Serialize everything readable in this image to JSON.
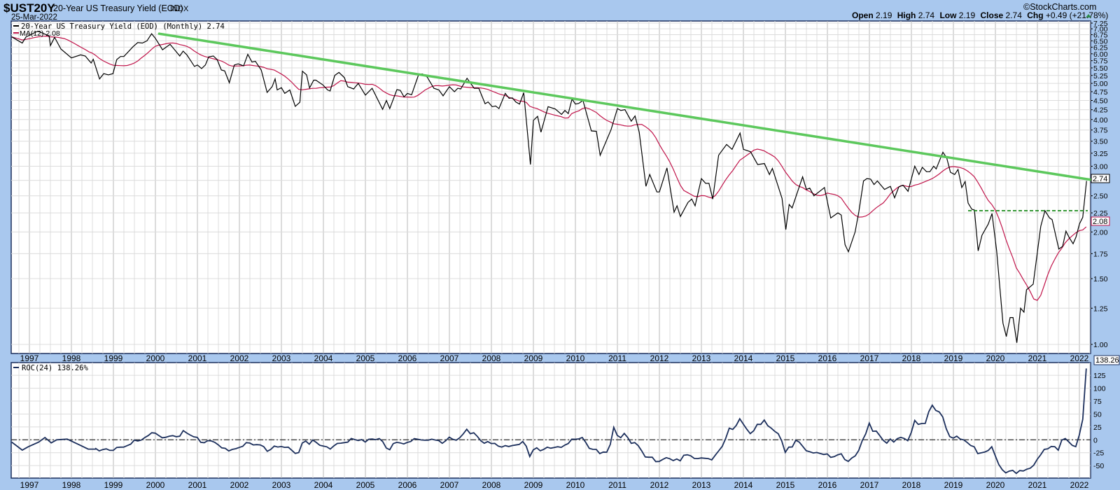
{
  "header": {
    "symbol": "$UST20Y",
    "name": "20-Year US Treasury Yield (EOD)",
    "exchange": "INDX",
    "date": "25-Mar-2022",
    "brand": "©StockCharts.com",
    "open_label": "Open",
    "open": "2.19",
    "high_label": "High",
    "high": "2.74",
    "low_label": "Low",
    "low": "2.19",
    "close_label": "Close",
    "close": "2.74",
    "chg_label": "Chg",
    "chg": "+0.49 (+21.78%)"
  },
  "legend": {
    "price": "20-Year US Treasury Yield (EOD) (Monthly) 2.74",
    "ma": "MA(12) 2.08",
    "roc": "ROC(24) 138.26%"
  },
  "tags": {
    "price": "2.74",
    "ma": "2.08",
    "roc": "138.26"
  },
  "colors": {
    "price": "#000000",
    "ma": "#c0144a",
    "trend": "#5cc85c",
    "support": "#1a8a1a",
    "roc": "#1c2f5c",
    "frame": "#1c2f5c"
  },
  "chart_data": [
    {
      "type": "line",
      "title": "20-Year US Treasury Yield (EOD) (Monthly)",
      "scale": "log",
      "ylim": [
        0.945,
        7.4
      ],
      "xlim": [
        1996.55,
        2022.22
      ],
      "y_ticks": [
        "7.25",
        "7.00",
        "6.75",
        "6.50",
        "6.25",
        "6.00",
        "5.75",
        "5.50",
        "5.25",
        "5.00",
        "4.75",
        "4.50",
        "4.25",
        "4.00",
        "3.75",
        "3.50",
        "3.25",
        "3.00",
        "2.75",
        "2.50",
        "2.25",
        "2.00",
        "1.75",
        "1.50",
        "1.25",
        "1.00"
      ],
      "x_ticks": [
        "1997",
        "1998",
        "1999",
        "2000",
        "2001",
        "2002",
        "2003",
        "2004",
        "2005",
        "2006",
        "2007",
        "2008",
        "2009",
        "2010",
        "2011",
        "2012",
        "2013",
        "2014",
        "2015",
        "2016",
        "2017",
        "2018",
        "2019",
        "2020",
        "2021",
        "2022"
      ],
      "ma_period": 12,
      "series_yield": [
        [
          1996.58,
          6.66
        ],
        [
          1996.83,
          6.41
        ],
        [
          1996.92,
          6.66
        ],
        [
          1997.2,
          6.9
        ],
        [
          1997.47,
          6.7
        ],
        [
          1997.5,
          6.31
        ],
        [
          1997.6,
          6.64
        ],
        [
          1997.75,
          6.18
        ],
        [
          1998.0,
          5.85
        ],
        [
          1998.22,
          5.96
        ],
        [
          1998.33,
          5.92
        ],
        [
          1998.47,
          5.67
        ],
        [
          1998.52,
          5.8
        ],
        [
          1998.67,
          5.14
        ],
        [
          1998.77,
          5.31
        ],
        [
          1998.88,
          5.27
        ],
        [
          1998.99,
          5.31
        ],
        [
          1999.08,
          5.79
        ],
        [
          1999.17,
          5.9
        ],
        [
          1999.25,
          5.9
        ],
        [
          1999.47,
          6.27
        ],
        [
          1999.58,
          6.43
        ],
        [
          1999.69,
          6.41
        ],
        [
          1999.8,
          6.5
        ],
        [
          1999.91,
          6.79
        ],
        [
          2000.0,
          6.6
        ],
        [
          2000.17,
          6.15
        ],
        [
          2000.35,
          6.36
        ],
        [
          2000.58,
          5.92
        ],
        [
          2000.66,
          6.1
        ],
        [
          2000.75,
          5.96
        ],
        [
          2000.93,
          5.55
        ],
        [
          2001.0,
          5.6
        ],
        [
          2001.1,
          5.48
        ],
        [
          2001.19,
          5.6
        ],
        [
          2001.27,
          5.89
        ],
        [
          2001.38,
          5.92
        ],
        [
          2001.47,
          5.79
        ],
        [
          2001.57,
          5.43
        ],
        [
          2001.65,
          5.4
        ],
        [
          2001.76,
          5.02
        ],
        [
          2001.88,
          5.6
        ],
        [
          2001.97,
          5.64
        ],
        [
          2002.1,
          5.57
        ],
        [
          2002.2,
          5.98
        ],
        [
          2002.3,
          5.7
        ],
        [
          2002.38,
          5.73
        ],
        [
          2002.52,
          5.43
        ],
        [
          2002.66,
          4.73
        ],
        [
          2002.78,
          4.9
        ],
        [
          2002.85,
          5.14
        ],
        [
          2002.9,
          4.8
        ],
        [
          2003.0,
          4.87
        ],
        [
          2003.08,
          4.7
        ],
        [
          2003.2,
          4.8
        ],
        [
          2003.33,
          4.34
        ],
        [
          2003.44,
          4.45
        ],
        [
          2003.5,
          5.39
        ],
        [
          2003.6,
          5.27
        ],
        [
          2003.67,
          4.86
        ],
        [
          2003.77,
          5.1
        ],
        [
          2003.82,
          5.1
        ],
        [
          2003.99,
          4.95
        ],
        [
          2004.1,
          4.8
        ],
        [
          2004.16,
          4.77
        ],
        [
          2004.27,
          5.25
        ],
        [
          2004.37,
          5.35
        ],
        [
          2004.5,
          5.18
        ],
        [
          2004.58,
          4.9
        ],
        [
          2004.72,
          4.83
        ],
        [
          2004.83,
          5.0
        ],
        [
          2005.0,
          4.65
        ],
        [
          2005.16,
          4.85
        ],
        [
          2005.41,
          4.26
        ],
        [
          2005.5,
          4.5
        ],
        [
          2005.58,
          4.28
        ],
        [
          2005.75,
          4.81
        ],
        [
          2005.83,
          4.79
        ],
        [
          2005.92,
          4.6
        ],
        [
          2006.0,
          4.7
        ],
        [
          2006.1,
          4.66
        ],
        [
          2006.27,
          5.29
        ],
        [
          2006.36,
          5.3
        ],
        [
          2006.47,
          5.2
        ],
        [
          2006.63,
          4.85
        ],
        [
          2006.75,
          4.8
        ],
        [
          2006.85,
          4.63
        ],
        [
          2007.0,
          4.9
        ],
        [
          2007.12,
          4.75
        ],
        [
          2007.2,
          4.85
        ],
        [
          2007.27,
          4.83
        ],
        [
          2007.42,
          5.16
        ],
        [
          2007.59,
          4.85
        ],
        [
          2007.7,
          4.85
        ],
        [
          2007.85,
          4.41
        ],
        [
          2007.92,
          4.46
        ],
        [
          2008.02,
          4.33
        ],
        [
          2008.1,
          4.35
        ],
        [
          2008.18,
          4.28
        ],
        [
          2008.33,
          4.7
        ],
        [
          2008.42,
          4.56
        ],
        [
          2008.5,
          4.57
        ],
        [
          2008.58,
          4.46
        ],
        [
          2008.67,
          4.4
        ],
        [
          2008.77,
          4.72
        ],
        [
          2008.93,
          3.03
        ],
        [
          2009.0,
          3.98
        ],
        [
          2009.1,
          4.08
        ],
        [
          2009.18,
          3.7
        ],
        [
          2009.35,
          4.33
        ],
        [
          2009.52,
          4.27
        ],
        [
          2009.67,
          4.13
        ],
        [
          2009.75,
          4.23
        ],
        [
          2009.83,
          4.15
        ],
        [
          2009.92,
          4.54
        ],
        [
          2010.0,
          4.4
        ],
        [
          2010.08,
          4.42
        ],
        [
          2010.18,
          4.5
        ],
        [
          2010.38,
          3.73
        ],
        [
          2010.5,
          3.72
        ],
        [
          2010.59,
          3.21
        ],
        [
          2010.7,
          3.43
        ],
        [
          2010.85,
          3.76
        ],
        [
          2011.0,
          4.28
        ],
        [
          2011.08,
          4.23
        ],
        [
          2011.18,
          4.25
        ],
        [
          2011.33,
          3.96
        ],
        [
          2011.42,
          4.09
        ],
        [
          2011.52,
          3.7
        ],
        [
          2011.68,
          2.65
        ],
        [
          2011.77,
          2.85
        ],
        [
          2011.94,
          2.56
        ],
        [
          2012.0,
          2.56
        ],
        [
          2012.18,
          2.97
        ],
        [
          2012.35,
          2.26
        ],
        [
          2012.42,
          2.35
        ],
        [
          2012.5,
          2.2
        ],
        [
          2012.68,
          2.4
        ],
        [
          2012.77,
          2.45
        ],
        [
          2012.85,
          2.35
        ],
        [
          2013.0,
          2.78
        ],
        [
          2013.1,
          2.7
        ],
        [
          2013.18,
          2.7
        ],
        [
          2013.27,
          2.45
        ],
        [
          2013.41,
          3.21
        ],
        [
          2013.47,
          3.28
        ],
        [
          2013.6,
          3.43
        ],
        [
          2013.73,
          3.33
        ],
        [
          2013.92,
          3.68
        ],
        [
          2014.0,
          3.33
        ],
        [
          2014.17,
          3.28
        ],
        [
          2014.34,
          3.03
        ],
        [
          2014.5,
          3.05
        ],
        [
          2014.62,
          2.85
        ],
        [
          2014.69,
          2.96
        ],
        [
          2014.92,
          2.46
        ],
        [
          2015.01,
          2.03
        ],
        [
          2015.09,
          2.37
        ],
        [
          2015.16,
          2.32
        ],
        [
          2015.41,
          2.81
        ],
        [
          2015.5,
          2.6
        ],
        [
          2015.58,
          2.62
        ],
        [
          2015.68,
          2.5
        ],
        [
          2015.93,
          2.63
        ],
        [
          2016.08,
          2.18
        ],
        [
          2016.25,
          2.25
        ],
        [
          2016.33,
          2.22
        ],
        [
          2016.42,
          1.85
        ],
        [
          2016.5,
          1.77
        ],
        [
          2016.66,
          2.0
        ],
        [
          2016.75,
          2.27
        ],
        [
          2016.86,
          2.74
        ],
        [
          2016.94,
          2.78
        ],
        [
          2017.03,
          2.77
        ],
        [
          2017.11,
          2.68
        ],
        [
          2017.19,
          2.74
        ],
        [
          2017.36,
          2.6
        ],
        [
          2017.5,
          2.65
        ],
        [
          2017.6,
          2.47
        ],
        [
          2017.7,
          2.64
        ],
        [
          2017.8,
          2.67
        ],
        [
          2017.92,
          2.57
        ],
        [
          2018.08,
          3.0
        ],
        [
          2018.18,
          2.85
        ],
        [
          2018.26,
          2.98
        ],
        [
          2018.36,
          2.9
        ],
        [
          2018.44,
          2.9
        ],
        [
          2018.53,
          3.0
        ],
        [
          2018.59,
          2.95
        ],
        [
          2018.75,
          3.27
        ],
        [
          2018.84,
          3.16
        ],
        [
          2018.93,
          2.89
        ],
        [
          2019.03,
          2.85
        ],
        [
          2019.11,
          2.94
        ],
        [
          2019.2,
          2.63
        ],
        [
          2019.28,
          2.73
        ],
        [
          2019.35,
          2.39
        ],
        [
          2019.44,
          2.3
        ],
        [
          2019.5,
          2.29
        ],
        [
          2019.59,
          1.78
        ],
        [
          2019.68,
          1.96
        ],
        [
          2019.83,
          2.1
        ],
        [
          2019.92,
          2.24
        ],
        [
          2020.03,
          1.78
        ],
        [
          2020.18,
          1.14
        ],
        [
          2020.26,
          1.05
        ],
        [
          2020.35,
          1.18
        ],
        [
          2020.42,
          1.18
        ],
        [
          2020.51,
          1.01
        ],
        [
          2020.6,
          1.25
        ],
        [
          2020.68,
          1.22
        ],
        [
          2020.74,
          1.4
        ],
        [
          2020.9,
          1.45
        ],
        [
          2021.08,
          2.07
        ],
        [
          2021.18,
          2.28
        ],
        [
          2021.29,
          2.18
        ],
        [
          2021.35,
          2.16
        ],
        [
          2021.51,
          1.8
        ],
        [
          2021.6,
          1.83
        ],
        [
          2021.68,
          2.01
        ],
        [
          2021.76,
          1.93
        ],
        [
          2021.85,
          1.86
        ],
        [
          2021.92,
          1.94
        ],
        [
          2022.0,
          2.1
        ],
        [
          2022.08,
          2.19
        ],
        [
          2022.17,
          2.74
        ]
      ],
      "trendline": [
        [
          2000.09,
          6.79
        ],
        [
          2022.27,
          2.76
        ]
      ],
      "support_line": {
        "from": 2019.35,
        "to": 2022.2,
        "value": 2.28
      }
    },
    {
      "type": "line",
      "title": "ROC(24)",
      "ylim": [
        -74,
        149
      ],
      "y_ticks": [
        125,
        100,
        75,
        50,
        25,
        0,
        -25,
        -50
      ],
      "zero_line": 0,
      "period": 24,
      "early_values": [
        [
          1996.58,
          -4.5
        ],
        [
          1996.83,
          -20
        ],
        [
          1996.97,
          -13.6
        ],
        [
          1997.22,
          -4.5
        ],
        [
          1997.37,
          4.5
        ],
        [
          1997.52,
          -6
        ],
        [
          1997.65,
          0
        ],
        [
          1997.9,
          1.4
        ],
        [
          1998.17,
          -9
        ],
        [
          1998.4,
          -18
        ],
        [
          1998.57,
          -18
        ]
      ],
      "last_value": 138.26
    }
  ]
}
